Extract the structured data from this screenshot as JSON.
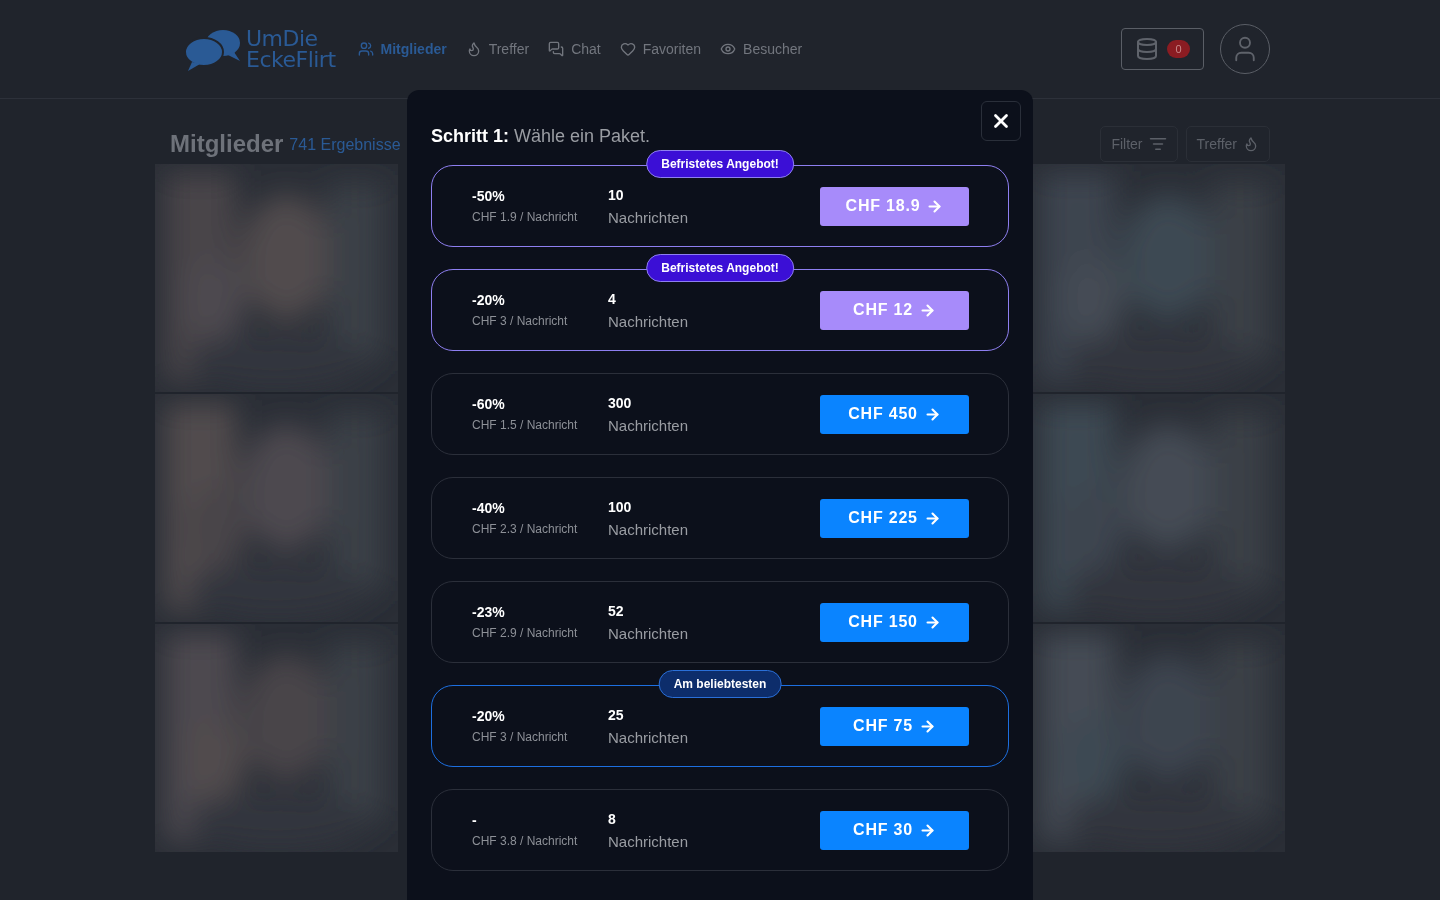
{
  "header": {
    "logo": {
      "line_1": "UmDie",
      "line_2": "EckeFlirt"
    },
    "nav": [
      {
        "label": "Mitglieder",
        "kind": "members",
        "selected": true
      },
      {
        "label": "Treffer",
        "kind": "flame",
        "selected": false
      },
      {
        "label": "Chat",
        "kind": "chat",
        "selected": false
      },
      {
        "label": "Favoriten",
        "kind": "heart",
        "selected": false
      },
      {
        "label": "Besucher",
        "kind": "eye",
        "selected": false
      }
    ],
    "credits_badge": "0"
  },
  "members": {
    "title": "Mitglieder",
    "count": "741 Ergebnisse",
    "filter_button": "Filter",
    "matches_button": "Treffer"
  },
  "modal": {
    "title": "**Schritt 1:** Wähle ein Paket.",
    "packages": [
      {
        "kind": "offer",
        "badge": "Befristetes Angebot!",
        "discount": "-50%",
        "per_message": "CHF 1.9 / Nachricht",
        "count": "10",
        "unit": "Nachrichten",
        "price": "CHF 18.9"
      },
      {
        "kind": "offer",
        "badge": "Befristetes Angebot!",
        "discount": "-20%",
        "per_message": "CHF 3 / Nachricht",
        "count": "4",
        "unit": "Nachrichten",
        "price": "CHF 12"
      },
      {
        "kind": "standard",
        "discount": "-60%",
        "per_message": "CHF 1.5 / Nachricht",
        "count": "300",
        "unit": "Nachrichten",
        "price": "CHF 450"
      },
      {
        "kind": "standard",
        "discount": "-40%",
        "per_message": "CHF 2.3 / Nachricht",
        "count": "100",
        "unit": "Nachrichten",
        "price": "CHF 225"
      },
      {
        "kind": "standard",
        "discount": "-23%",
        "per_message": "CHF 2.9 / Nachricht",
        "count": "52",
        "unit": "Nachrichten",
        "price": "CHF 150"
      },
      {
        "kind": "popular",
        "badge": "Am beliebtesten",
        "discount": "-20%",
        "per_message": "CHF 3 / Nachricht",
        "count": "25",
        "unit": "Nachrichten",
        "price": "CHF 75"
      },
      {
        "kind": "standard",
        "discount": "-",
        "per_message": "CHF 3.8 / Nachricht",
        "count": "8",
        "unit": "Nachrichten",
        "price": "CHF 30"
      }
    ]
  }
}
